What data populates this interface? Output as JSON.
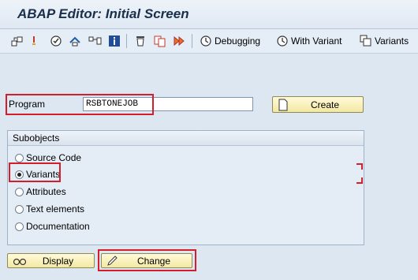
{
  "window": {
    "title": "ABAP Editor: Initial Screen"
  },
  "toolbar": {
    "icons": [
      "other-object-icon",
      "where-used-icon",
      "check-icon",
      "activate-icon",
      "test-icon",
      "info-icon",
      "delete-icon",
      "copy-icon",
      "execute-icon"
    ],
    "debugging_label": "Debugging",
    "with_variant_label": "With Variant",
    "variants_label": "Variants"
  },
  "program": {
    "label": "Program",
    "value": "RSBTONEJOB"
  },
  "create_button": {
    "label": "Create"
  },
  "subobjects": {
    "title": "Subobjects",
    "options": [
      {
        "label": "Source Code",
        "selected": false
      },
      {
        "label": "Variants",
        "selected": true
      },
      {
        "label": "Attributes",
        "selected": false
      },
      {
        "label": "Text elements",
        "selected": false
      },
      {
        "label": "Documentation",
        "selected": false
      }
    ]
  },
  "buttons": {
    "display_label": "Display",
    "change_label": "Change"
  },
  "colors": {
    "highlight": "#d31f2b",
    "button_bg": "#f8efb8",
    "background": "#dde7f2"
  }
}
